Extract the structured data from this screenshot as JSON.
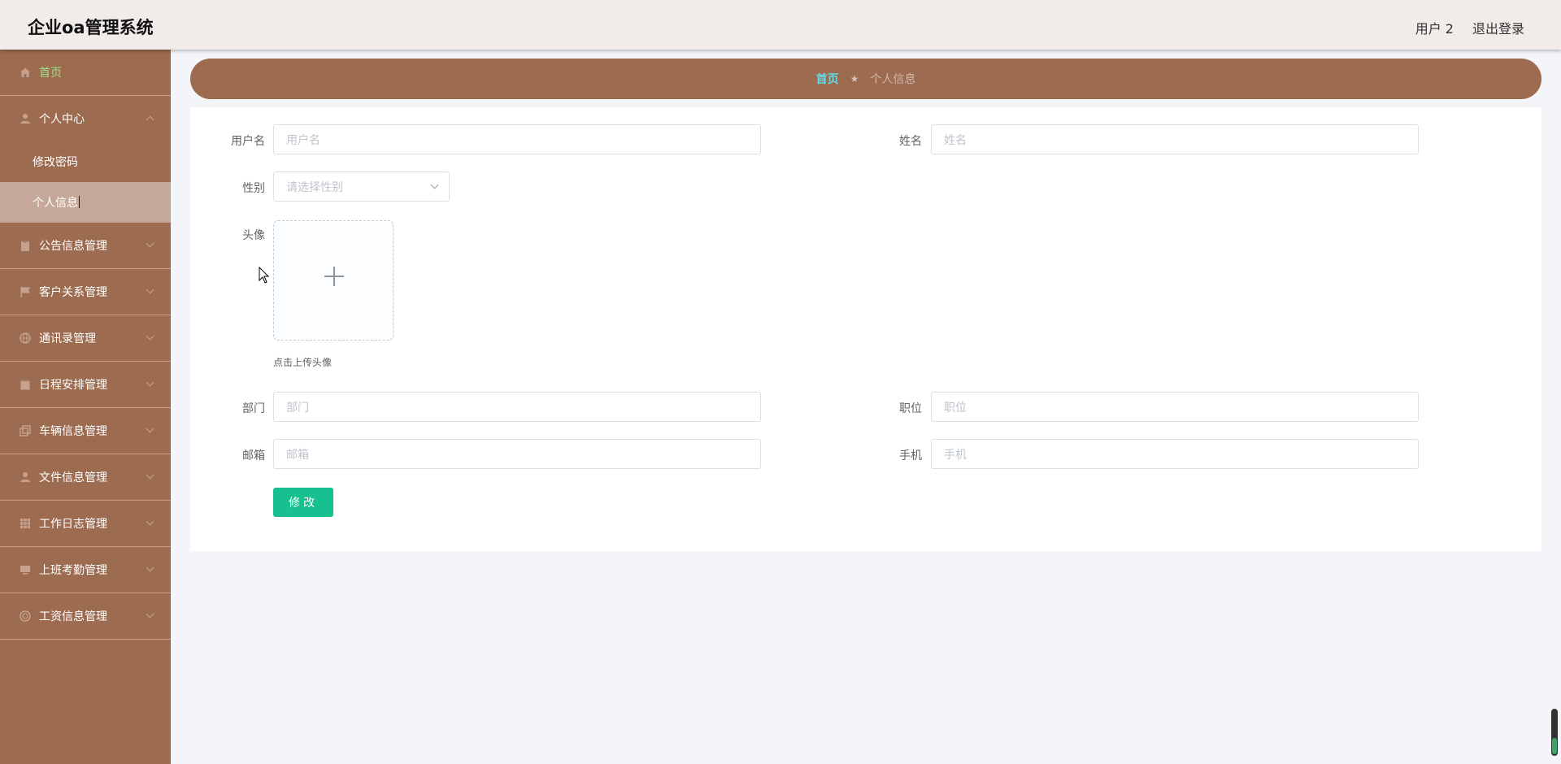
{
  "header": {
    "title": "企业oa管理系统",
    "user": "用户 2",
    "logout": "退出登录"
  },
  "sidebar": {
    "home": "首页",
    "personal_center": "个人中心",
    "sub_items": [
      "修改密码",
      "个人信息"
    ],
    "items": [
      {
        "label": "公告信息管理",
        "icon": "clipboard-icon"
      },
      {
        "label": "客户关系管理",
        "icon": "flag-icon"
      },
      {
        "label": "通讯录管理",
        "icon": "globe-icon"
      },
      {
        "label": "日程安排管理",
        "icon": "calendar-icon"
      },
      {
        "label": "车辆信息管理",
        "icon": "copy-icon"
      },
      {
        "label": "文件信息管理",
        "icon": "user-icon"
      },
      {
        "label": "工作日志管理",
        "icon": "grid-icon"
      },
      {
        "label": "上班考勤管理",
        "icon": "monitor-icon"
      },
      {
        "label": "工资信息管理",
        "icon": "circle-icon"
      }
    ]
  },
  "breadcrumb": {
    "home": "首页",
    "separator": "★",
    "current": "个人信息"
  },
  "form": {
    "username_label": "用户名",
    "username_placeholder": "用户名",
    "name_label": "姓名",
    "name_placeholder": "姓名",
    "gender_label": "性别",
    "gender_placeholder": "请选择性别",
    "avatar_label": "头像",
    "avatar_tip": "点击上传头像",
    "dept_label": "部门",
    "dept_placeholder": "部门",
    "position_label": "职位",
    "position_placeholder": "职位",
    "email_label": "邮箱",
    "email_placeholder": "邮箱",
    "phone_label": "手机",
    "phone_placeholder": "手机",
    "submit": "修改"
  },
  "colors": {
    "sidebar": "#9c6b50",
    "header": "#f1ebea",
    "accent_button": "#18c08f",
    "home_active": "#9fe08a"
  }
}
